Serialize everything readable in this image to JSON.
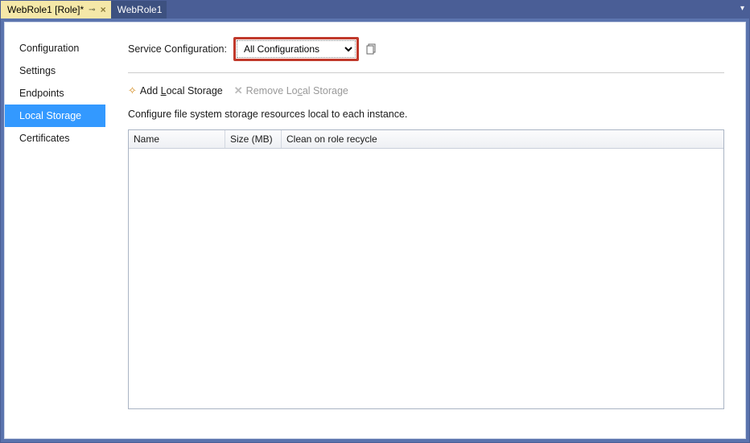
{
  "tabs": [
    {
      "label": "WebRole1 [Role]*",
      "active": true
    },
    {
      "label": "WebRole1",
      "active": false
    }
  ],
  "sidebar": {
    "items": [
      {
        "label": "Configuration"
      },
      {
        "label": "Settings"
      },
      {
        "label": "Endpoints"
      },
      {
        "label": "Local Storage",
        "active": true
      },
      {
        "label": "Certificates"
      }
    ]
  },
  "config": {
    "label": "Service Configuration:",
    "selected": "All Configurations"
  },
  "toolbar": {
    "add_prefix": "Add ",
    "add_underline": "L",
    "add_suffix": "ocal Storage",
    "remove_prefix": "Remove Lo",
    "remove_underline": "c",
    "remove_suffix": "al Storage"
  },
  "description": "Configure file system storage resources local to each instance.",
  "grid": {
    "columns": [
      "Name",
      "Size (MB)",
      "Clean on role recycle"
    ],
    "rows": []
  }
}
